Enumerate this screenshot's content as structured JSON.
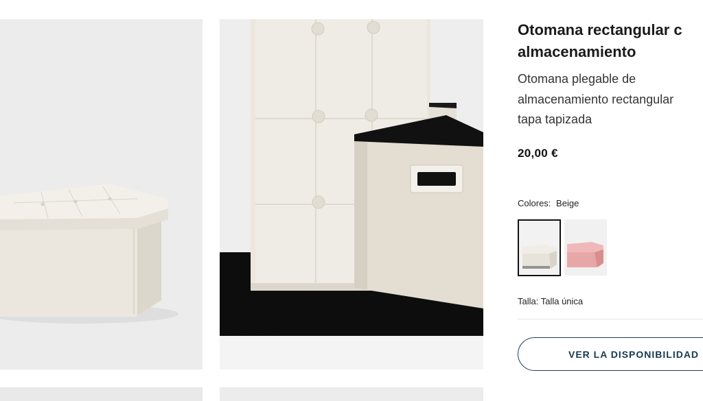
{
  "product": {
    "title_line1": "Otomana rectangular c",
    "title_line2": "almacenamiento",
    "description_line1": "Otomana plegable de",
    "description_line2": "almacenamiento rectangular",
    "description_line3": "tapa tapizada",
    "price": "20,00 €"
  },
  "colors": {
    "label": "Colores:",
    "selected": "Beige",
    "swatches": [
      {
        "name": "beige",
        "color": "#ece8e1",
        "selected": true
      },
      {
        "name": "pink",
        "color": "#e8a3a3",
        "selected": false
      }
    ]
  },
  "size": {
    "text": "Talla: Talla única"
  },
  "availability_button": {
    "label": "VER LA DISPONIBILIDAD"
  },
  "palette": {
    "ottoman": "#ece8df",
    "ottoman_shadow": "#d9d4ca",
    "rug": "#0c0c0c",
    "photo_bg": "#eeeeee",
    "button_border": "#1f3c57"
  }
}
